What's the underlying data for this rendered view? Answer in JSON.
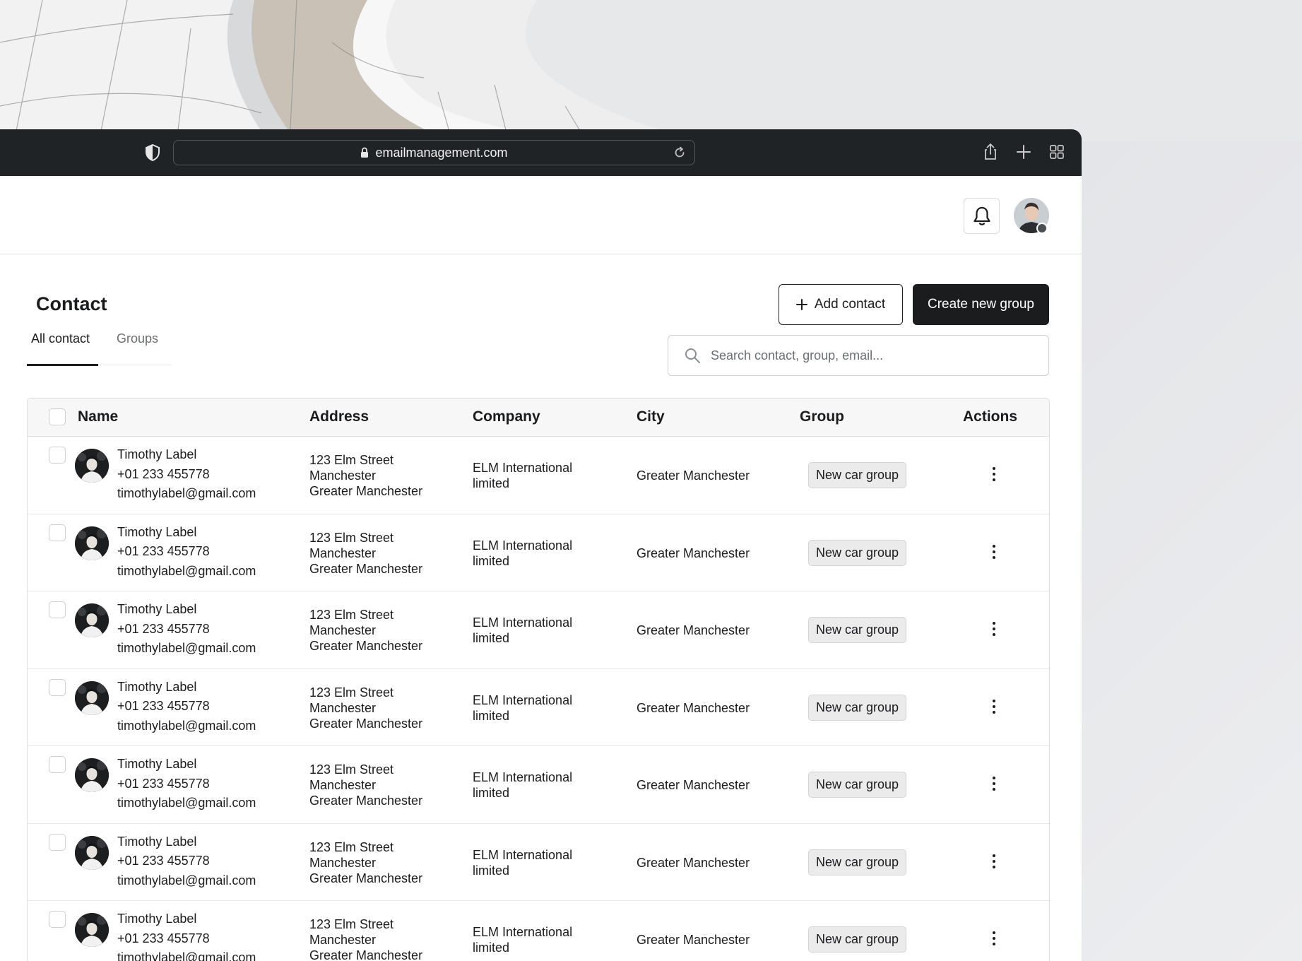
{
  "browser": {
    "url": "emailmanagement.com"
  },
  "page": {
    "title": "Contact",
    "add_contact_label": "Add contact",
    "create_group_label": "Create new group",
    "tabs": [
      {
        "label": "All contact",
        "active": true
      },
      {
        "label": "Groups",
        "active": false
      }
    ],
    "search_placeholder": "Search contact, group, email..."
  },
  "table": {
    "columns": [
      "Name",
      "Address",
      "Company",
      "City",
      "Group",
      "Actions"
    ],
    "rows": [
      {
        "name": "Timothy Label",
        "phone": "+01 233 455778",
        "email": "timothylabel@gmail.com",
        "address": [
          "123 Elm Street",
          "Manchester",
          "Greater Manchester"
        ],
        "company": [
          "ELM International",
          "limited"
        ],
        "city": "Greater Manchester",
        "group": "New car group"
      },
      {
        "name": "Timothy Label",
        "phone": "+01 233 455778",
        "email": "timothylabel@gmail.com",
        "address": [
          "123 Elm Street",
          "Manchester",
          "Greater Manchester"
        ],
        "company": [
          "ELM International",
          "limited"
        ],
        "city": "Greater Manchester",
        "group": "New car group"
      },
      {
        "name": "Timothy Label",
        "phone": "+01 233 455778",
        "email": "timothylabel@gmail.com",
        "address": [
          "123 Elm Street",
          "Manchester",
          "Greater Manchester"
        ],
        "company": [
          "ELM International",
          "limited"
        ],
        "city": "Greater Manchester",
        "group": "New car group"
      },
      {
        "name": "Timothy Label",
        "phone": "+01 233 455778",
        "email": "timothylabel@gmail.com",
        "address": [
          "123 Elm Street",
          "Manchester",
          "Greater Manchester"
        ],
        "company": [
          "ELM International",
          "limited"
        ],
        "city": "Greater Manchester",
        "group": "New car group"
      },
      {
        "name": "Timothy Label",
        "phone": "+01 233 455778",
        "email": "timothylabel@gmail.com",
        "address": [
          "123 Elm Street",
          "Manchester",
          "Greater Manchester"
        ],
        "company": [
          "ELM International",
          "limited"
        ],
        "city": "Greater Manchester",
        "group": "New car group"
      },
      {
        "name": "Timothy Label",
        "phone": "+01 233 455778",
        "email": "timothylabel@gmail.com",
        "address": [
          "123 Elm Street",
          "Manchester",
          "Greater Manchester"
        ],
        "company": [
          "ELM International",
          "limited"
        ],
        "city": "Greater Manchester",
        "group": "New car group"
      },
      {
        "name": "Timothy Label",
        "phone": "+01 233 455778",
        "email": "timothylabel@gmail.com",
        "address": [
          "123 Elm Street",
          "Manchester",
          "Greater Manchester"
        ],
        "company": [
          "ELM International",
          "limited"
        ],
        "city": "Greater Manchester",
        "group": "New car group"
      }
    ]
  },
  "icons": [
    "shield-icon",
    "lock-icon",
    "reload-icon",
    "share-icon",
    "new-tab-icon",
    "tab-overview-icon",
    "bell-icon",
    "plus-icon",
    "search-icon",
    "kebab-menu-icon"
  ],
  "colors": {
    "primary_button": "#1b1c1e",
    "browser_chrome": "#202325",
    "badge_bg": "#ebebec"
  }
}
